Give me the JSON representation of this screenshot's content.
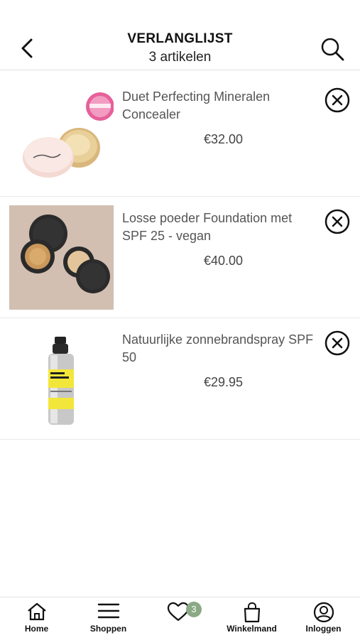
{
  "header": {
    "title": "VERLANGLIJST",
    "subtitle": "3 artikelen",
    "back_icon": "chevron-left-icon",
    "search_icon": "search-icon"
  },
  "items": [
    {
      "name": "Duet Perfecting Mineralen Concealer",
      "price": "€32.00",
      "image": "concealer-jar-with-award-badge"
    },
    {
      "name": "Losse poeder Foundation met SPF 25 - vegan",
      "price": "€40.00",
      "image": "loose-powder-jars"
    },
    {
      "name": "Natuurlijke zonnebrandspray SPF 50",
      "price": "€29.95",
      "image": "sunscreen-spray-bottle"
    }
  ],
  "tabs": [
    {
      "label": "Home",
      "icon": "home-icon"
    },
    {
      "label": "Shoppen",
      "icon": "menu-icon"
    },
    {
      "label": "",
      "icon": "heart-icon",
      "badge": "3"
    },
    {
      "label": "Winkelmand",
      "icon": "shopping-bag-icon"
    },
    {
      "label": "Inloggen",
      "icon": "user-icon"
    }
  ],
  "colors": {
    "badge": "#8aa985",
    "divider": "#e2e2e2"
  }
}
